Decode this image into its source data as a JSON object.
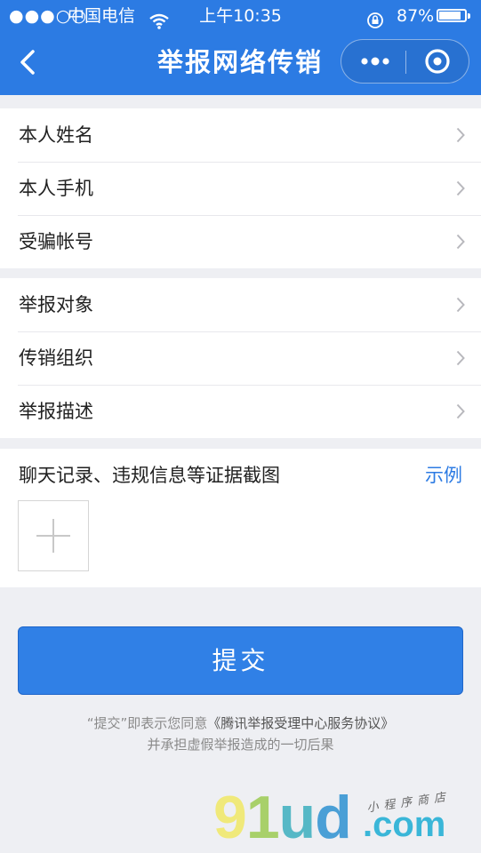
{
  "status_bar": {
    "signal": "●●●○○",
    "carrier": "中国电信",
    "time": "上午10:35",
    "battery": "87%",
    "battery_level": 0.87
  },
  "nav": {
    "title": "举报网络传销"
  },
  "groups": [
    {
      "items": [
        "本人姓名",
        "本人手机",
        "受骗帐号"
      ]
    },
    {
      "items": [
        "举报对象",
        "传销组织",
        "举报描述"
      ]
    }
  ],
  "evidence": {
    "title": "聊天记录、违规信息等证据截图",
    "example": "示例"
  },
  "submit_label": "提交",
  "agreement": {
    "prefix": "“提交”即表示您同意",
    "link": "《腾讯举报受理中心服务协议》",
    "line2": "并承担虚假举报造成的一切后果"
  },
  "watermark": {
    "text": "91ud",
    "suffix": ".com",
    "sub": "小程序商店"
  },
  "colors": {
    "primary": "#2c7be3",
    "background": "#eeeff3"
  }
}
